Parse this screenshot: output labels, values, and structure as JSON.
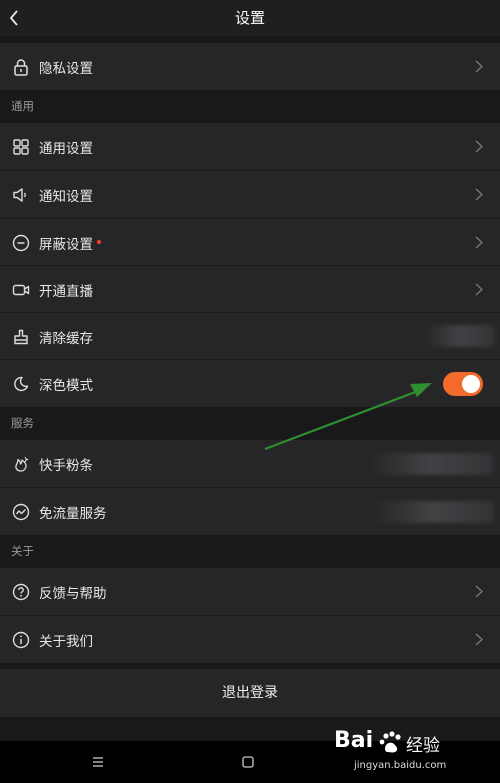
{
  "header": {
    "title": "设置"
  },
  "rows": {
    "privacy": "隐私设置",
    "general": "通用设置",
    "notify": "通知设置",
    "block": "屏蔽设置",
    "live": "开通直播",
    "cache": "清除缓存",
    "dark": "深色模式",
    "fans": "快手粉条",
    "freeflow": "免流量服务",
    "feedback": "反馈与帮助",
    "about": "关于我们"
  },
  "sections": {
    "general": "通用",
    "service": "服务",
    "about": "关于"
  },
  "dark_mode_enabled": true,
  "logout_label": "退出登录",
  "watermark": {
    "brand": "Bai",
    "brand_cn": "经验",
    "url": "jingyan.baidu.com"
  },
  "icons": {
    "back": "back-arrow-icon",
    "privacy": "lock-icon",
    "general": "grid-icon",
    "notify": "speaker-icon",
    "block": "minus-circle-icon",
    "live": "camera-icon",
    "cache": "brush-icon",
    "dark": "moon-icon",
    "fans": "flame-icon",
    "freeflow": "wave-circle-icon",
    "feedback": "question-circle-icon",
    "about": "info-circle-icon",
    "annotation": "green-arrow-annotation"
  },
  "colors": {
    "accent": "#f26a2c",
    "background": "#19191b",
    "row": "#262628",
    "annotation": "#2f8f2f",
    "badge": "#ff3b30"
  }
}
